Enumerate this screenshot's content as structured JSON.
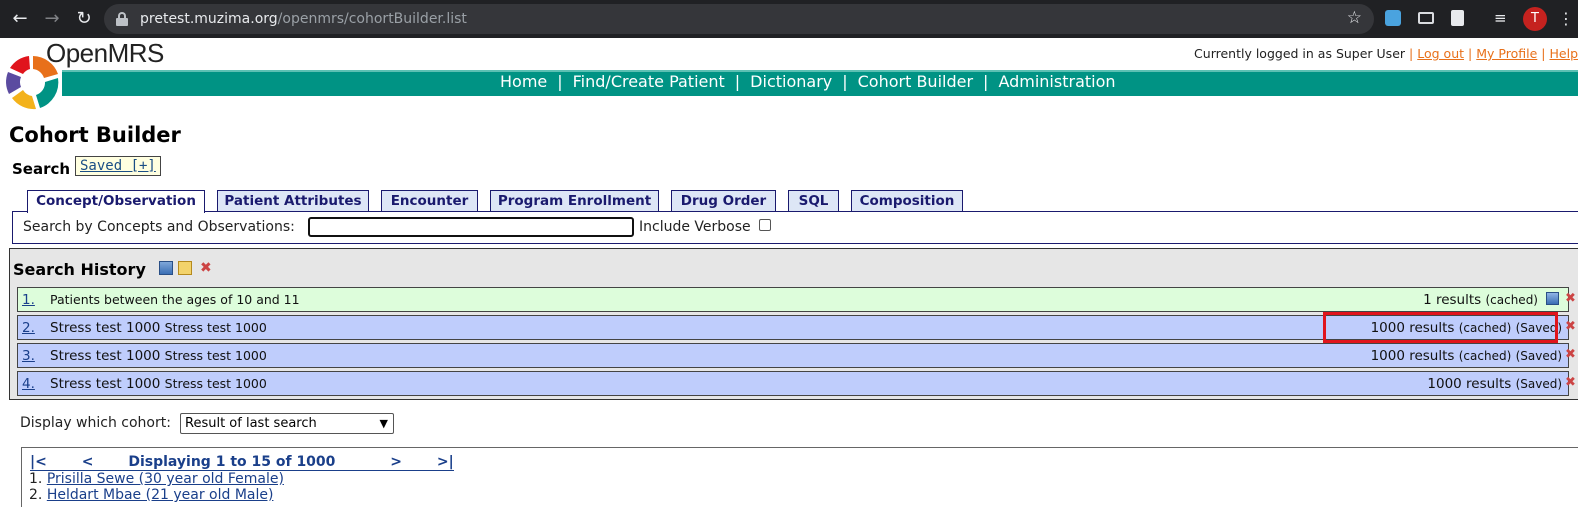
{
  "browser": {
    "url_host": "pretest.muzima.org",
    "url_path": "/openmrs/cohortBuilder.list",
    "avatar_letter": "T"
  },
  "header": {
    "brand": "OpenMRS",
    "logged_in_text": "Currently logged in as Super User",
    "logout": "Log out",
    "profile": "My Profile",
    "help": "Help"
  },
  "nav": {
    "items": [
      "Home",
      "Find/Create Patient",
      "Dictionary",
      "Cohort Builder",
      "Administration"
    ]
  },
  "page": {
    "title": "Cohort Builder",
    "search_label": "Search",
    "saved_link": "Saved [+]"
  },
  "tabs": [
    {
      "label": "Concept/Observation",
      "active": true
    },
    {
      "label": "Patient Attributes",
      "active": false
    },
    {
      "label": "Encounter",
      "active": false
    },
    {
      "label": "Program Enrollment",
      "active": false
    },
    {
      "label": "Drug Order",
      "active": false
    },
    {
      "label": "SQL",
      "active": false
    },
    {
      "label": "Composition",
      "active": false
    }
  ],
  "concept_search": {
    "label": "Search by Concepts and Observations:",
    "value": "",
    "verbose_label": "Include Verbose",
    "verbose_checked": false
  },
  "history": {
    "title": "Search History",
    "rows": [
      {
        "num": "1.",
        "desc": "Patients between the ages of 10 and 11",
        "sub": "",
        "result": "1 results",
        "cached": "(cached)",
        "saved": "",
        "color": "green"
      },
      {
        "num": "2.",
        "desc": "Stress test 1000",
        "sub": "Stress test 1000",
        "result": "1000 results",
        "cached": "(cached)",
        "saved": "(Saved)",
        "color": "blue"
      },
      {
        "num": "3.",
        "desc": "Stress test 1000",
        "sub": "Stress test 1000",
        "result": "1000 results",
        "cached": "(cached)",
        "saved": "(Saved)",
        "color": "blue"
      },
      {
        "num": "4.",
        "desc": "Stress test 1000",
        "sub": "Stress test 1000",
        "result": "1000 results",
        "cached": "",
        "saved": "(Saved)",
        "color": "blue"
      }
    ]
  },
  "display": {
    "label": "Display which cohort:",
    "selected": "Result of last search"
  },
  "results": {
    "first": "|<",
    "prev": "<",
    "summary": "Displaying 1 to 15 of 1000",
    "next": ">",
    "last": ">|",
    "people": [
      {
        "num": "1.",
        "name": "Prisilla Sewe (30 year old Female)"
      },
      {
        "num": "2.",
        "name": "Heldart Mbae (21 year old Male)"
      }
    ]
  }
}
